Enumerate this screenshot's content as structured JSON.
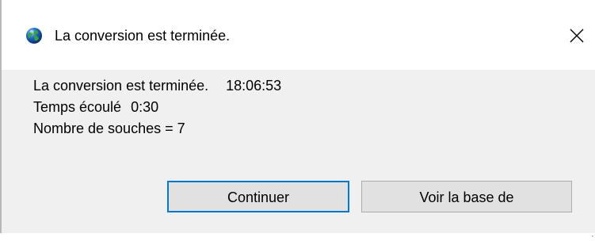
{
  "window": {
    "title": "La conversion est terminée.",
    "icon": "globe-icon",
    "close_icon": "close-icon"
  },
  "message": {
    "line1_text": "La conversion est terminée.",
    "line1_time": "18:06:53",
    "line2_label": "Temps écoulé",
    "line2_value": "0:30",
    "line3": "Nombre de souches = 7"
  },
  "buttons": {
    "continue_label": "Continuer",
    "view_db_label": "Voir la base de"
  },
  "colors": {
    "content_bg": "#f0f0f0",
    "button_bg": "#e1e1e1",
    "focus_border": "#0078d7"
  }
}
